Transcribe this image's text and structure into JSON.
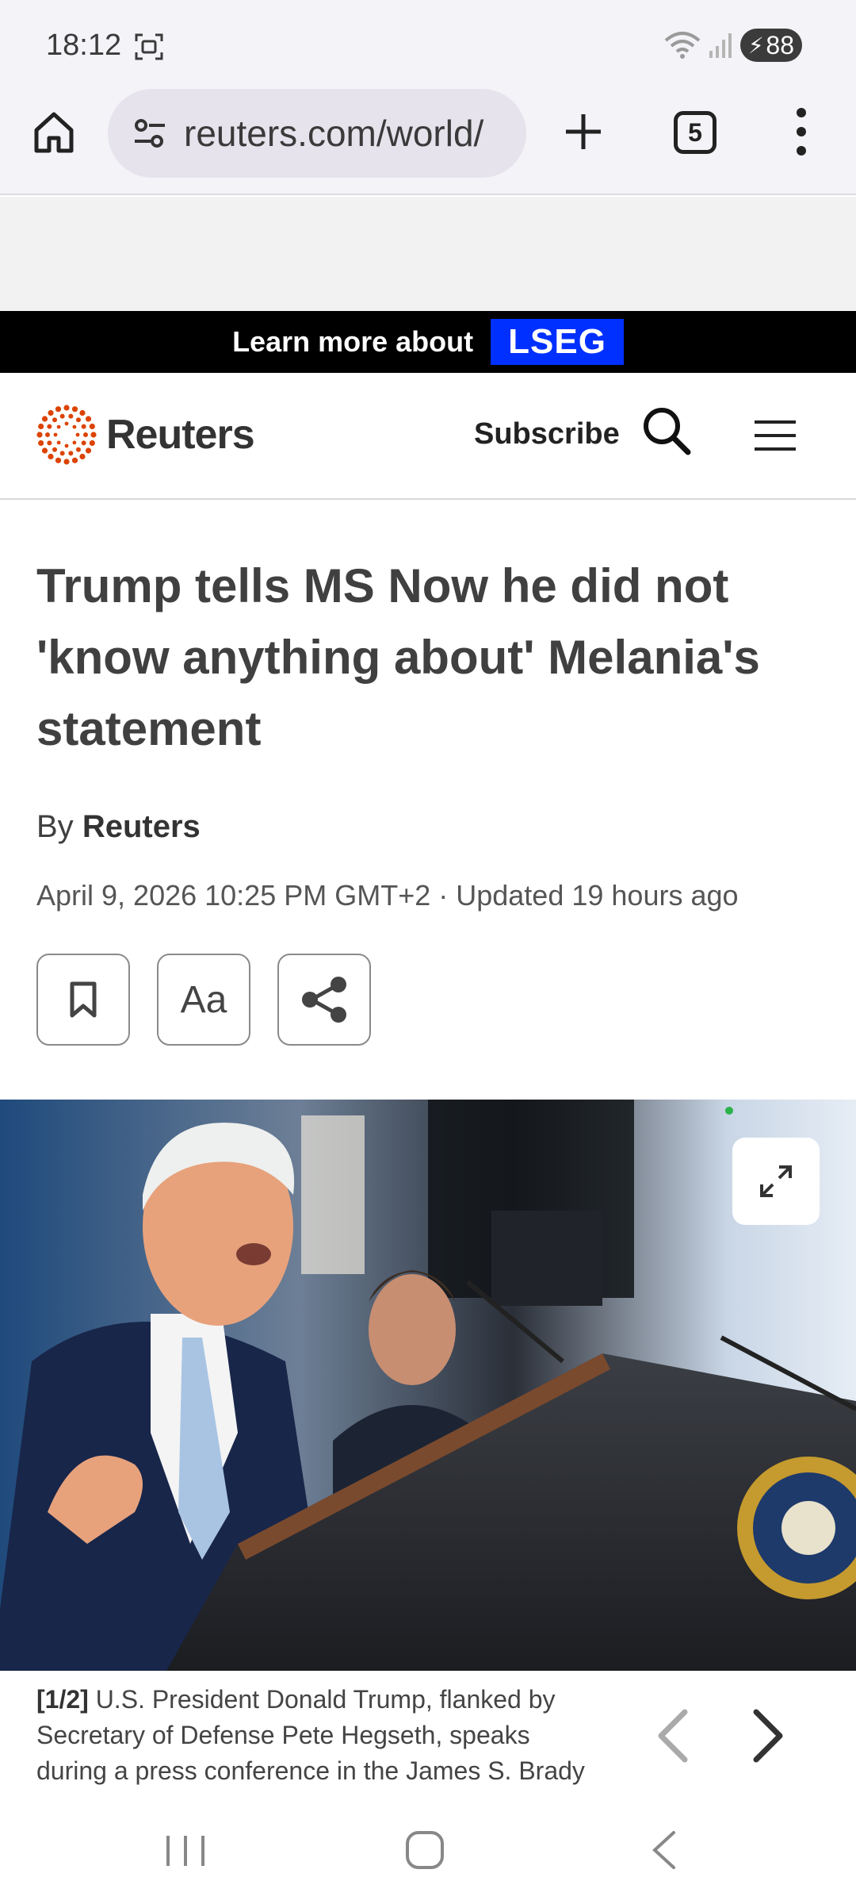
{
  "status_bar": {
    "time": "18:12",
    "battery": "88"
  },
  "browser": {
    "url": "reuters.com/world/",
    "tab_count": "5"
  },
  "promo": {
    "text": "Learn more about",
    "brand": "LSEG"
  },
  "site": {
    "logo_text": "Reuters",
    "subscribe_label": "Subscribe",
    "brand_color": "#dc4300"
  },
  "article": {
    "headline": "Trump tells MS Now he did not 'know anything about' Melania's statement",
    "byline_prefix": "By",
    "byline_author": "Reuters",
    "dateline": "April 9, 2026 10:25 PM GMT+2 · Updated 19 hours ago",
    "font_size_label": "Aa"
  },
  "photo": {
    "caption_count": "[1/2]",
    "caption_text": "U.S. President Donald Trump, flanked by Secretary of Defense Pete Hegseth, speaks during a press conference in the James S. Brady Press"
  },
  "icons": [
    "screenshot-icon",
    "wifi-icon",
    "signal-icon",
    "home-icon",
    "tune-icon",
    "plus-icon",
    "more-vert-icon",
    "search-icon",
    "menu-icon",
    "bookmark-icon",
    "share-icon",
    "expand-icon",
    "chevron-left-icon",
    "chevron-right-icon"
  ]
}
